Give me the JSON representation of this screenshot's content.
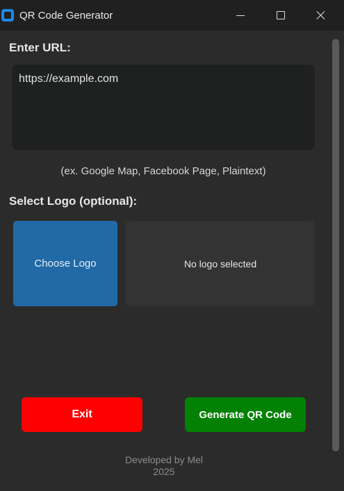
{
  "window": {
    "title": "QR Code Generator",
    "icon": "qr-app-icon",
    "controls": {
      "minimize": "minimize-icon",
      "maximize": "maximize-icon",
      "close": "close-icon"
    }
  },
  "url_section": {
    "label": "Enter URL:",
    "value": "https://example.com",
    "hint": "(ex. Google Map, Facebook Page, Plaintext)"
  },
  "logo_section": {
    "label": "Select Logo (optional):",
    "choose_button": "Choose Logo",
    "status": "No logo selected"
  },
  "actions": {
    "exit_label": "Exit",
    "generate_label": "Generate QR Code"
  },
  "footer": {
    "credit": "Developed by Mel",
    "year": "2025"
  },
  "colors": {
    "background": "#2b2b2b",
    "titlebar": "#202020",
    "choose_logo": "#216aa7",
    "exit": "#fe0000",
    "generate": "#038104"
  }
}
